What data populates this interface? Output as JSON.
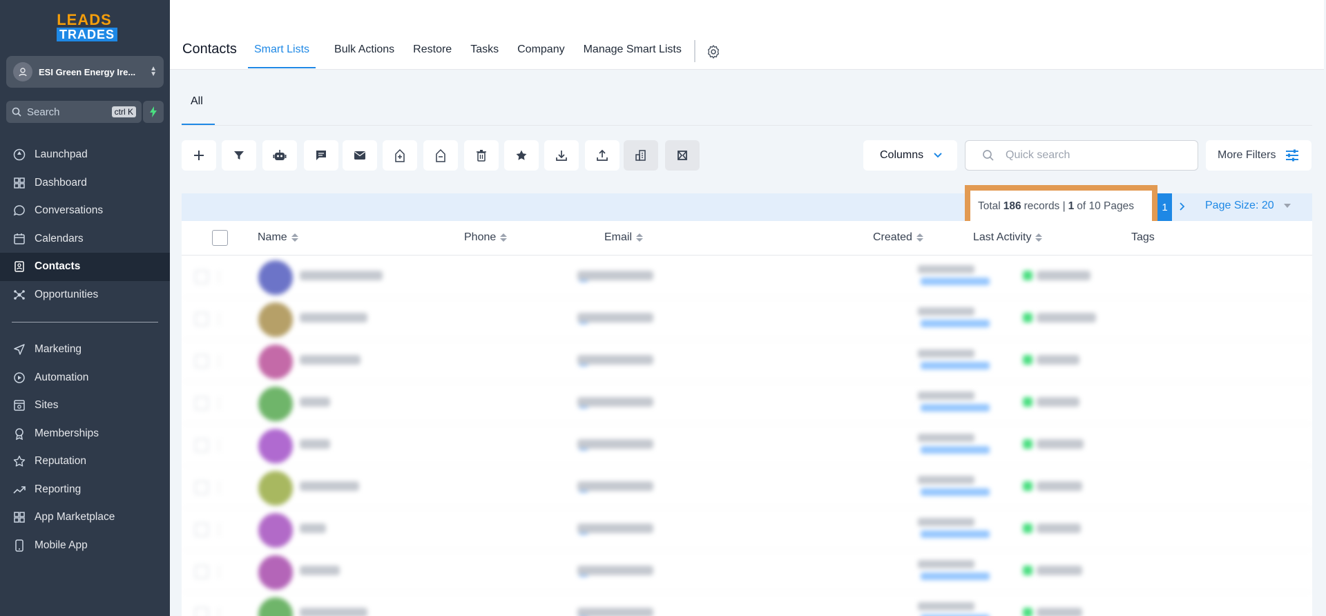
{
  "brand": {
    "line1": "LEADS",
    "line2": "TRADES"
  },
  "account": {
    "name": "ESI Green Energy Ire..."
  },
  "search": {
    "placeholder": "Search",
    "shortcut": "ctrl K"
  },
  "sidebar": {
    "items": [
      {
        "label": "Launchpad",
        "icon": "launchpad-icon"
      },
      {
        "label": "Dashboard",
        "icon": "dashboard-icon"
      },
      {
        "label": "Conversations",
        "icon": "chat-icon"
      },
      {
        "label": "Calendars",
        "icon": "calendar-icon"
      },
      {
        "label": "Contacts",
        "icon": "contacts-icon",
        "active": true
      },
      {
        "label": "Opportunities",
        "icon": "opportunities-icon"
      }
    ],
    "items2": [
      {
        "label": "Marketing",
        "icon": "send-icon"
      },
      {
        "label": "Automation",
        "icon": "automation-icon"
      },
      {
        "label": "Sites",
        "icon": "sites-icon"
      },
      {
        "label": "Memberships",
        "icon": "memberships-icon"
      },
      {
        "label": "Reputation",
        "icon": "star-icon"
      },
      {
        "label": "Reporting",
        "icon": "reporting-icon"
      },
      {
        "label": "App Marketplace",
        "icon": "marketplace-icon"
      },
      {
        "label": "Mobile App",
        "icon": "mobile-icon"
      }
    ]
  },
  "header": {
    "title": "Contacts",
    "tabs": [
      "Smart Lists",
      "Bulk Actions",
      "Restore",
      "Tasks",
      "Company",
      "Manage Smart Lists"
    ],
    "active_tab": "Smart Lists"
  },
  "subtab": {
    "all": "All"
  },
  "toolbar": {
    "columns_label": "Columns",
    "quick_search_placeholder": "Quick search",
    "more_filters_label": "More Filters"
  },
  "pagination": {
    "total_prefix": "Total",
    "total_records": "186",
    "records_word": "records |",
    "current_page": "1",
    "of_pages": "of 10 Pages",
    "page_button": "1",
    "page_size": "Page Size: 20"
  },
  "table": {
    "columns": [
      "Name",
      "Phone",
      "Email",
      "Created",
      "Last Activity",
      "Tags"
    ]
  },
  "colors": {
    "accent": "#1e88e5",
    "sidebar_bg": "#2f3a4a",
    "highlight_border": "#e29a52"
  }
}
